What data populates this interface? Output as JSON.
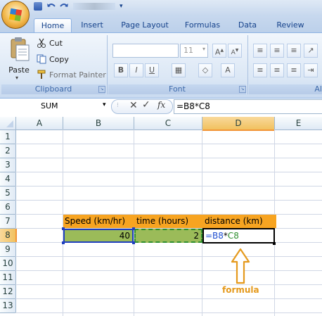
{
  "quick_access": {
    "office_button": "office-logo-icon"
  },
  "tabs": [
    "Home",
    "Insert",
    "Page Layout",
    "Formulas",
    "Data",
    "Review"
  ],
  "clipboard": {
    "paste": "Paste",
    "cut": "Cut",
    "copy": "Copy",
    "format_painter": "Format Painter",
    "label": "Clipboard"
  },
  "font": {
    "size": "11",
    "label": "Font"
  },
  "alignment": {
    "label": "Al"
  },
  "formula_bar": {
    "name_box": "SUM",
    "fx": "fx",
    "content": "=B8*C8"
  },
  "columns": [
    "A",
    "B",
    "C",
    "D",
    "E"
  ],
  "rows": [
    "1",
    "2",
    "3",
    "4",
    "5",
    "6",
    "7",
    "8",
    "9",
    "10",
    "11",
    "12",
    "13"
  ],
  "cells": {
    "B7": "Speed (km/hr)",
    "C7": "time (hours)",
    "D7": "distance (km)",
    "B8": "40",
    "C8": "2",
    "D8_ref1": "=B8",
    "D8_op": "*",
    "D8_ref2": "C8"
  },
  "annotation": "formula",
  "colors": {
    "header_orange": "#f7a421",
    "input_green": "#9bbb59",
    "ref_blue": "#1f4fd0",
    "ref_green": "#2f8f2f",
    "annotation_orange": "#e59a1d"
  }
}
